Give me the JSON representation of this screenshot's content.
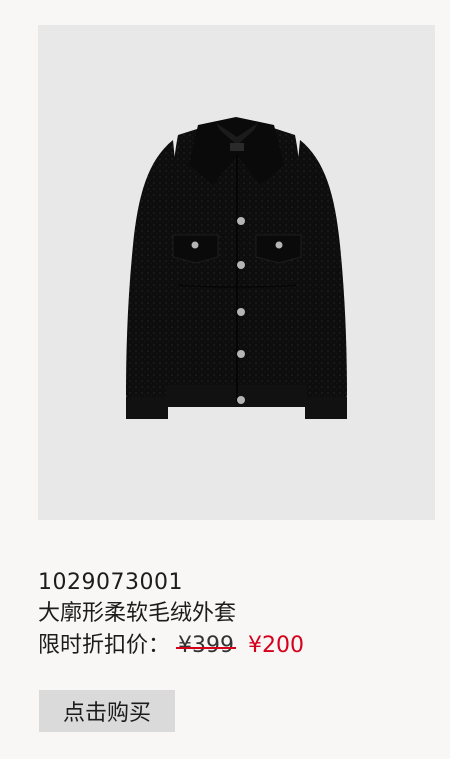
{
  "product": {
    "sku": "1029073001",
    "name": "大廓形柔软毛绒外套",
    "price_label": "限时折扣价：",
    "original_price": "¥399",
    "sale_price": "¥200",
    "image_icon": "black-sherpa-jacket-image"
  },
  "actions": {
    "buy_label": "点击购买"
  },
  "colors": {
    "background": "#f8f7f5",
    "image_background": "#e8e8e8",
    "sale_price": "#d6001c",
    "strike_line": "#d6001c",
    "button_background": "#dadada"
  }
}
